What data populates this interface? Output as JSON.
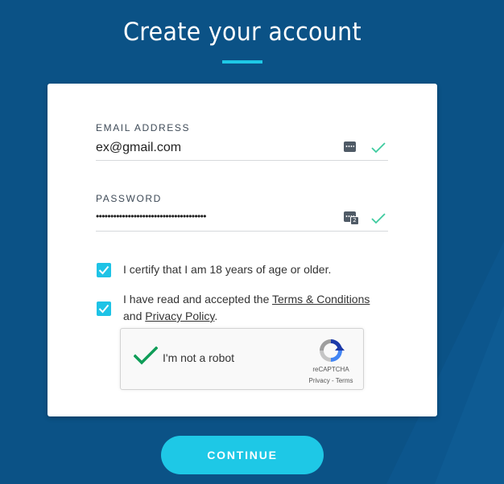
{
  "page": {
    "title": "Create your account"
  },
  "form": {
    "email": {
      "label": "EMAIL ADDRESS",
      "value": "ex@gmail.com"
    },
    "password": {
      "label": "PASSWORD",
      "value": "••••••••••••••••••••••••••••••••••••••",
      "manager_badge": "2"
    },
    "age_check": {
      "label": "I certify that I am 18 years of age or older.",
      "checked": true
    },
    "terms_check": {
      "prefix": "I have read and accepted the ",
      "terms_link": "Terms & Conditions",
      "and_text": "and ",
      "privacy_link": "Privacy Policy",
      "suffix": ".",
      "checked": true
    },
    "recaptcha": {
      "label": "I'm not a robot",
      "brand": "reCAPTCHA",
      "privacy": "Privacy",
      "separator": " - ",
      "terms": "Terms",
      "checked": true
    }
  },
  "actions": {
    "continue_label": "CONTINUE"
  },
  "icons": {
    "password_manager": "password-manager-icon",
    "valid": "checkmark-icon",
    "checkbox": "checkbox-checked-icon",
    "recaptcha_logo": "recaptcha-logo-icon"
  },
  "colors": {
    "background": "#0b5286",
    "accent": "#1ec8e6",
    "valid": "#3ecb9f",
    "recaptcha_check": "#0f9d58"
  }
}
